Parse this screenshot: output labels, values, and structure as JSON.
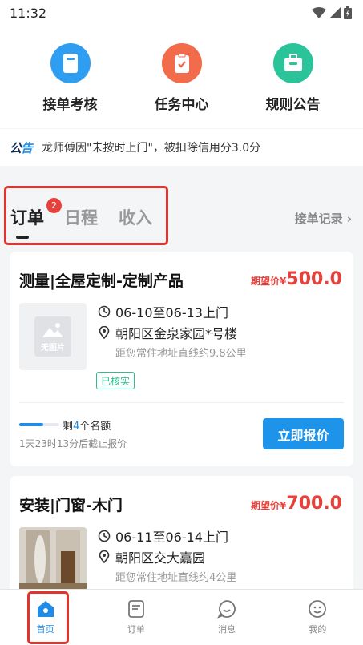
{
  "status_bar": {
    "time": "11:32"
  },
  "quick_actions": [
    {
      "label": "接单考核",
      "icon": "document-icon",
      "color": "#2f9ef0"
    },
    {
      "label": "任务中心",
      "icon": "clipboard-check-icon",
      "color": "#f26b4a"
    },
    {
      "label": "规则公告",
      "icon": "briefcase-icon",
      "color": "#2bc49a"
    }
  ],
  "notice": {
    "tag_a": "公",
    "tag_b": "告",
    "text": "龙师傅因\"未按时上门\"，被扣除信用分3.0分"
  },
  "tabs": {
    "items": [
      "订单",
      "日程",
      "收入"
    ],
    "badge": "2",
    "record_link": "接单记录 ›"
  },
  "orders": [
    {
      "title": "测量|全屋定制-定制产品",
      "price_label": "期望价",
      "currency": "¥",
      "price": "500.0",
      "thumb_text": "无图片",
      "schedule": "06-10至06-13上门",
      "address": "朝阳区金泉家园*号楼",
      "distance": "距您常住地址直线约9.8公里",
      "verified": "已核实",
      "quota_prefix": "剩",
      "quota_num": "4",
      "quota_suffix": "个名额",
      "quota_progress": 0.6,
      "deadline": "1天23时13分后截止报价",
      "button": "立即报价"
    },
    {
      "title": "安装|门窗-木门",
      "price_label": "期望价",
      "currency": "¥",
      "price": "700.0",
      "schedule": "06-11至06-14上门",
      "address": "朝阳区交大嘉园",
      "distance": "距您常住地址直线约4公里"
    }
  ],
  "bottom_nav": [
    {
      "label": "首页",
      "icon": "home-icon"
    },
    {
      "label": "订单",
      "icon": "order-icon"
    },
    {
      "label": "消息",
      "icon": "message-icon"
    },
    {
      "label": "我的",
      "icon": "profile-icon"
    }
  ],
  "colors": {
    "accent": "#1f8de8",
    "price": "#e8403a",
    "highlight": "#e0342c"
  }
}
